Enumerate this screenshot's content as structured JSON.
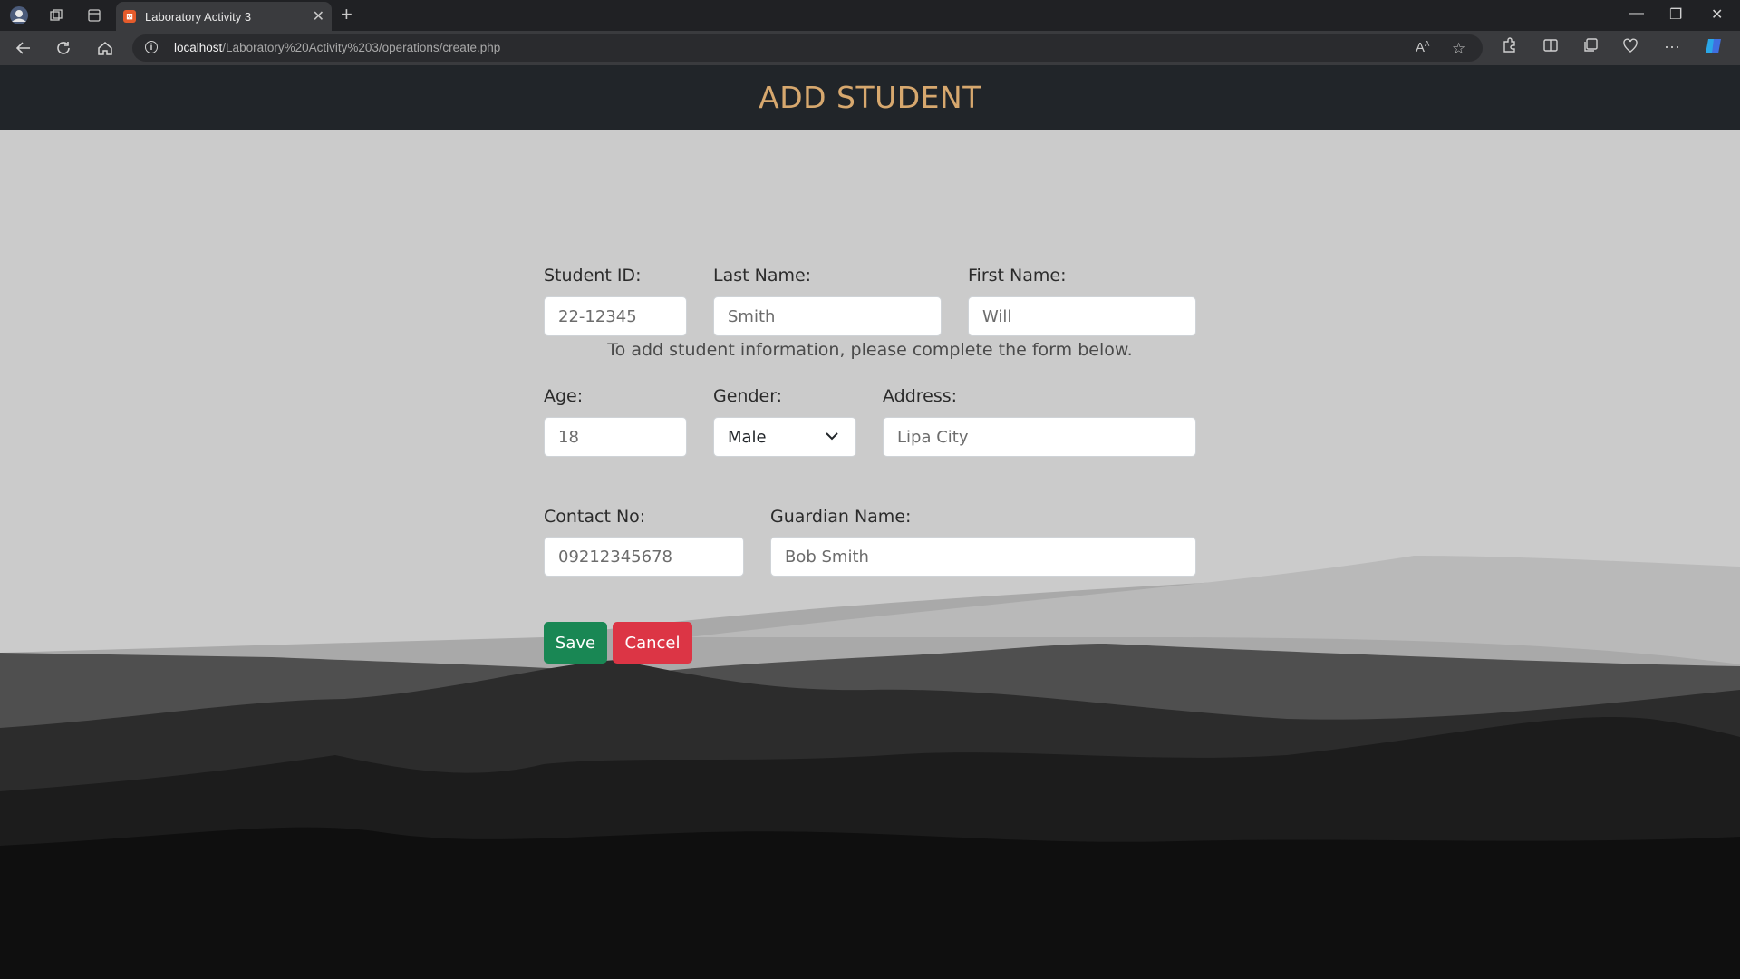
{
  "browser": {
    "tab_title": "Laboratory Activity 3",
    "url_host": "localhost",
    "url_path": "/Laboratory%20Activity%203/operations/create.php"
  },
  "page": {
    "title": "ADD STUDENT",
    "intro": "To add student information, please complete the form below."
  },
  "form": {
    "student_id": {
      "label": "Student ID:",
      "value": "22-12345"
    },
    "last_name": {
      "label": "Last Name:",
      "value": "Smith"
    },
    "first_name": {
      "label": "First Name:",
      "value": "Will"
    },
    "age": {
      "label": "Age:",
      "value": "18"
    },
    "gender": {
      "label": "Gender:",
      "value": "Male"
    },
    "address": {
      "label": "Address:",
      "value": "Lipa City"
    },
    "contact_no": {
      "label": "Contact No:",
      "value": "09212345678"
    },
    "guardian_name": {
      "label": "Guardian Name:",
      "value": "Bob Smith"
    },
    "save_label": "Save",
    "cancel_label": "Cancel"
  },
  "colors": {
    "header_bg": "#212529",
    "title_color": "#d7a86e",
    "save_bg": "#198754",
    "cancel_bg": "#dc3545",
    "page_bg": "#cbcbcb"
  }
}
